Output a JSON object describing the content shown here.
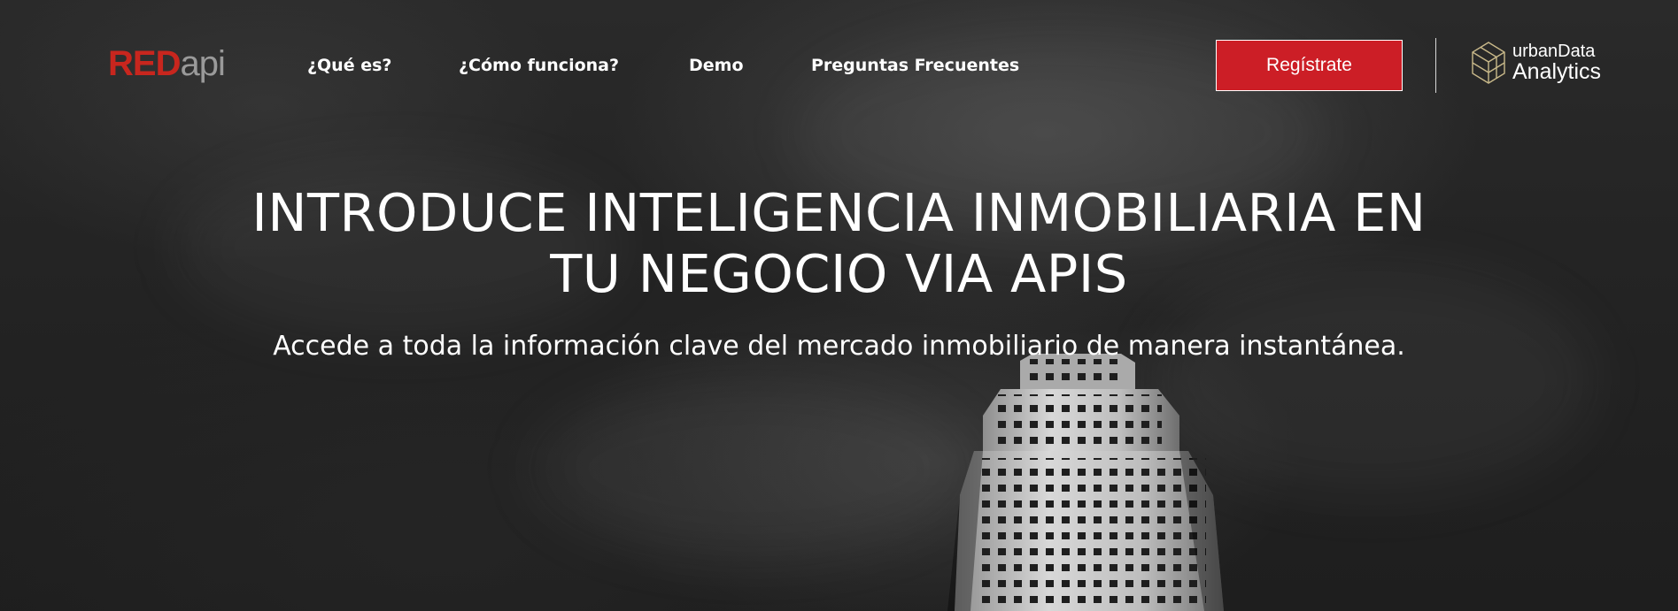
{
  "brand": {
    "logo_red": "RED",
    "logo_api": "api",
    "logo_red_color": "#c8261e"
  },
  "nav": {
    "items": [
      {
        "label": "¿Qué es?"
      },
      {
        "label": "¿Cómo funciona?"
      },
      {
        "label": "Demo"
      },
      {
        "label": "Preguntas Frecuentes"
      }
    ]
  },
  "header": {
    "register_label": "Regístrate",
    "register_color": "#cc1e26",
    "partner_line1": "urbanData",
    "partner_line2": "Analytics",
    "partner_icon": "cube-icon"
  },
  "hero": {
    "headline_line1": "INTRODUCE INTELIGENCIA INMOBILIARIA EN",
    "headline_line2": "TU NEGOCIO VIA APIS",
    "subheadline": "Accede a toda la información clave del mercado inmobiliario de manera instantánea.",
    "background_image": "skyscraper-photo"
  }
}
